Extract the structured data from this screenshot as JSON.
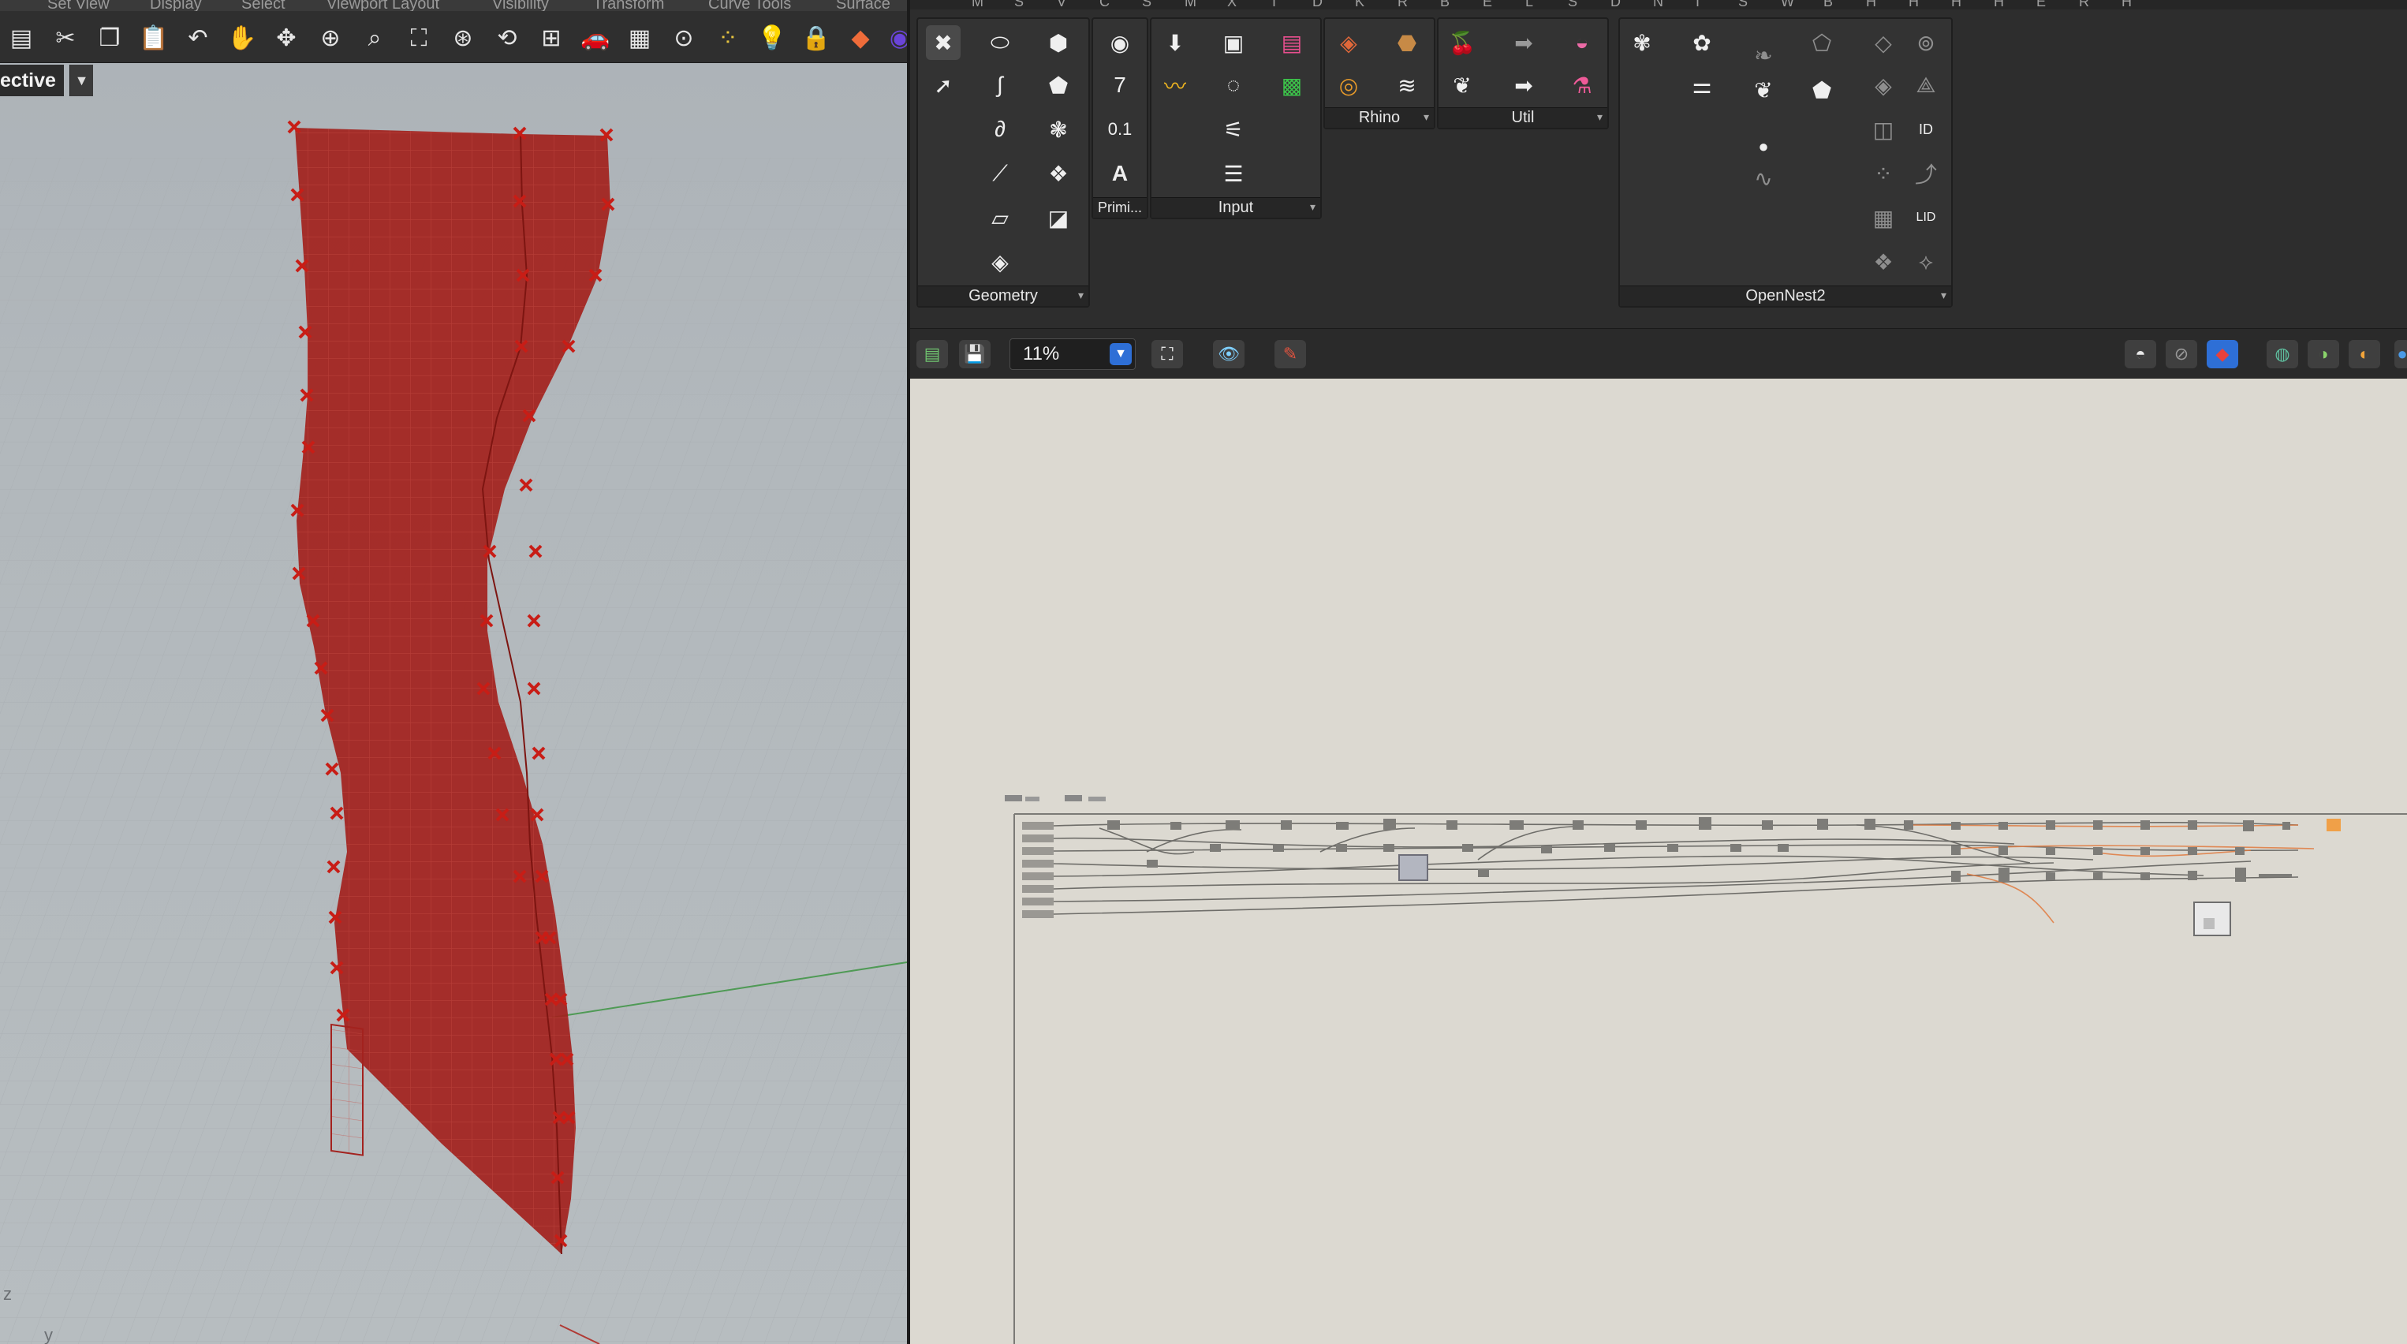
{
  "rhino": {
    "menu": [
      "Set View",
      "Display",
      "Select",
      "Viewport Layout",
      "Visibility",
      "Transform",
      "Curve Tools",
      "Surface"
    ],
    "toolbar_icons": [
      "new-file-icon",
      "cut-icon",
      "copy-icon",
      "paste-icon",
      "undo-icon",
      "pan-hand-icon",
      "rotate-view-icon",
      "zoom-icon",
      "zoom-window-icon",
      "zoom-extents-icon",
      "zoom-selected-icon",
      "rotate-icon",
      "four-viewports-icon",
      "car-icon",
      "grid-plane-icon",
      "cplane-icon",
      "points-icon",
      "light-icon",
      "lock-icon",
      "shaded-icon",
      "color-wheel-icon"
    ],
    "viewport": {
      "name": "ective",
      "axis_z": "z",
      "axis_y": "y"
    },
    "colors": {
      "surface": "#a3221e",
      "control_point": "#c81d16",
      "green_axis": "#4f9a55"
    }
  },
  "gh": {
    "tab_letters": [
      "M",
      "S",
      "V",
      "C",
      "S",
      "M",
      "X",
      "T",
      "D",
      "K",
      "R",
      "B",
      "E",
      "L",
      "S",
      "D",
      "N",
      "I",
      "S",
      "W",
      "B",
      "H",
      "H",
      "H",
      "H",
      "E",
      "R",
      "H"
    ],
    "panels": [
      {
        "id": "geometry",
        "label": "Geometry"
      },
      {
        "id": "primitive",
        "label": "Primi..."
      },
      {
        "id": "input",
        "label": "Input"
      },
      {
        "id": "rhino",
        "label": "Rhino"
      },
      {
        "id": "util",
        "label": "Util"
      },
      {
        "id": "opennest",
        "label": "OpenNest2"
      }
    ],
    "zoom": "11%",
    "colors": {
      "canvas": "#dcd9d1",
      "zoom_accent": "#2e6fd6",
      "wire_orange": "#e07a3f"
    }
  }
}
